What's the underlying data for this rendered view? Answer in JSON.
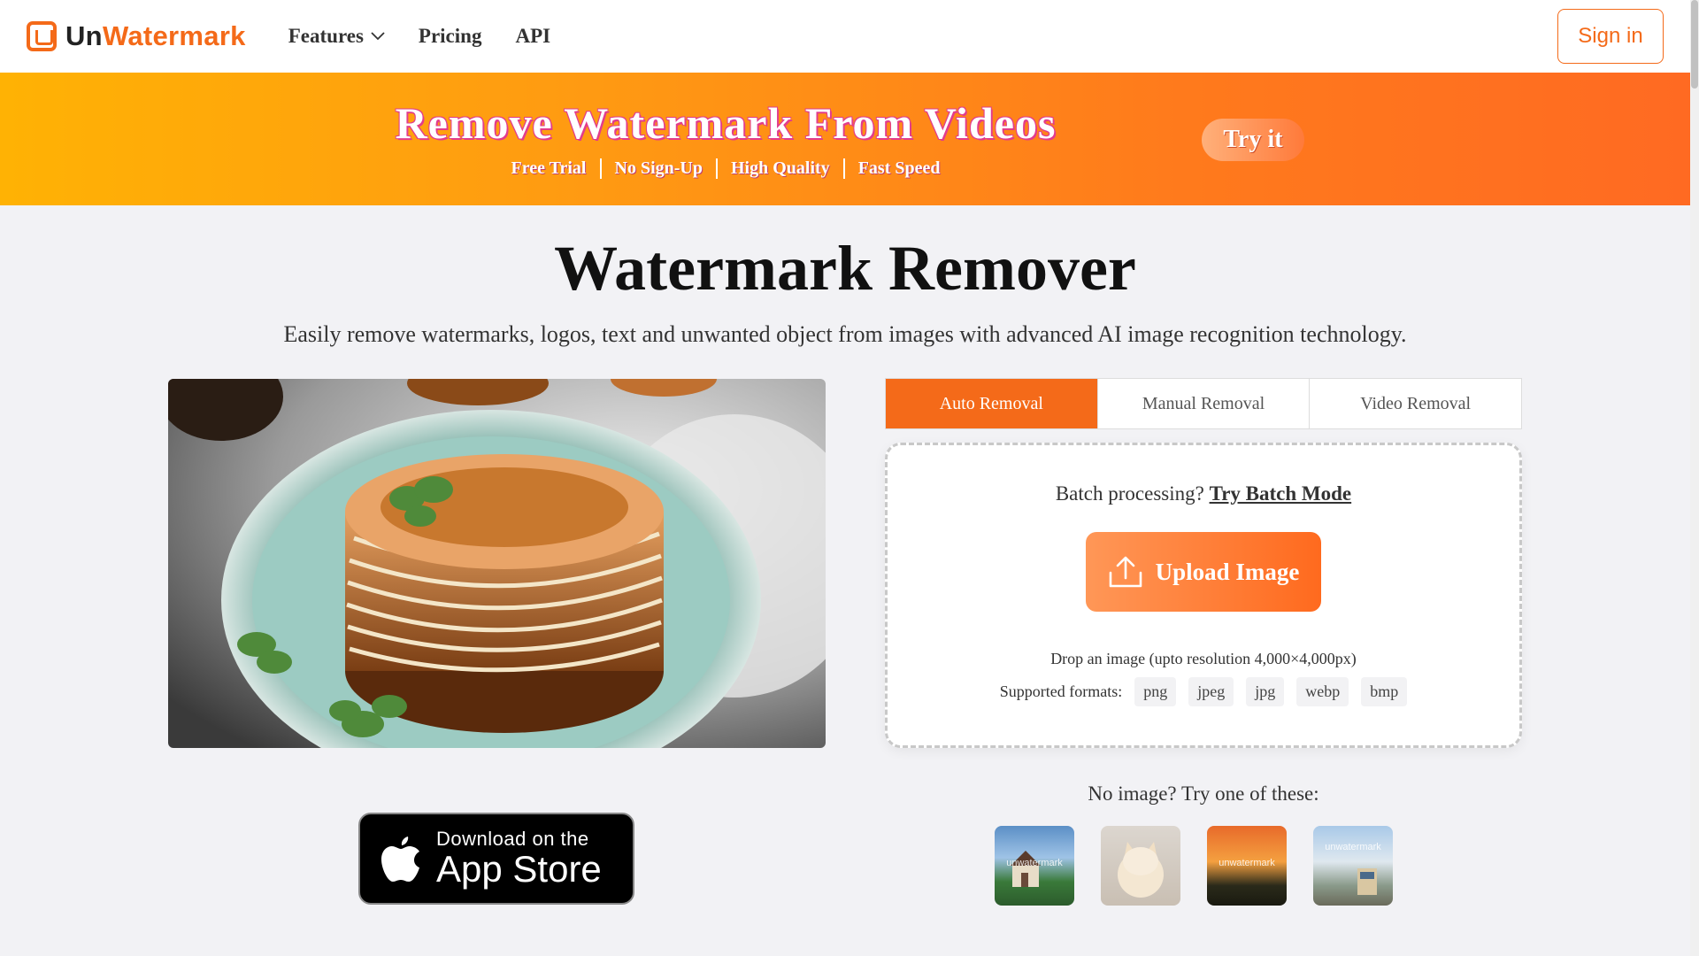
{
  "header": {
    "logo_un": "Un",
    "logo_wm": "Watermark",
    "nav": [
      {
        "label": "Features",
        "has_dropdown": true
      },
      {
        "label": "Pricing"
      },
      {
        "label": "API"
      }
    ],
    "signin_label": "Sign in"
  },
  "banner": {
    "title": "Remove Watermark From Videos",
    "tags": [
      "Free Trial",
      "No Sign-Up",
      "High Quality",
      "Fast Speed"
    ],
    "try_label": "Try it"
  },
  "main": {
    "title": "Watermark Remover",
    "subtitle": "Easily remove watermarks, logos, text and unwanted object from images with advanced AI image recognition technology."
  },
  "tabs": [
    {
      "label": "Auto Removal",
      "active": true
    },
    {
      "label": "Manual Removal",
      "active": false
    },
    {
      "label": "Video Removal",
      "active": false
    }
  ],
  "upload": {
    "batch_prefix": "Batch processing?",
    "batch_link": "Try Batch Mode",
    "button_label": "Upload Image",
    "drop_text": "Drop an image (upto resolution 4,000×4,000px)",
    "formats_label": "Supported formats:",
    "formats": [
      "png",
      "jpeg",
      "jpg",
      "webp",
      "bmp"
    ]
  },
  "appstore": {
    "small": "Download on the",
    "big": "App Store"
  },
  "samples": {
    "title": "No image? Try one of these:",
    "items": [
      {
        "name": "house-sample",
        "label": "unwatermark"
      },
      {
        "name": "cat-sample",
        "label": ""
      },
      {
        "name": "sunset-sample",
        "label": "unwatermark"
      },
      {
        "name": "train-sample",
        "label": "unwatermark"
      }
    ]
  },
  "colors": {
    "accent": "#f46a19",
    "banner_start": "#ffb204",
    "banner_end": "#ff6a22"
  }
}
